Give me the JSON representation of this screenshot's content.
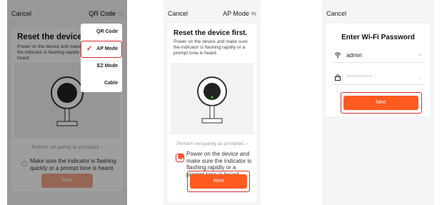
{
  "screen1": {
    "cancel": "Cancel",
    "mode_label": "QR Code",
    "mode_icon": "swap-icon",
    "title": "Reset the device firs",
    "description": "Power on the device and make sure the indicator is flashing rapidly o heard.",
    "pairing_link": "Perform net pairing as prompted.",
    "checkbox_label": "Make sure the indicator is flashing quickly or a prompt tone is heard.",
    "next_label": "Next",
    "menu": [
      {
        "label": "QR Code",
        "checked": false
      },
      {
        "label": "AP Mode",
        "checked": true
      },
      {
        "label": "EZ Mode",
        "checked": false
      },
      {
        "label": "Cable",
        "checked": false
      }
    ]
  },
  "screen2": {
    "cancel": "Cancel",
    "mode_label": "AP Mode",
    "mode_icon": "swap-icon",
    "title": "Reset the device first.",
    "description": "Power on the device and make sure the indicator is flashing rapidly or a prompt tone is heard.",
    "pairing_link": "Perform net pairing as prompted.",
    "checkbox_label": "Power on the device and make sure the indicator is flashing rapidly or a prompt tone is heard.",
    "next_label": "Next"
  },
  "screen3": {
    "cancel": "Cancel",
    "title": "Enter Wi-Fi Password",
    "ssid_value": "admin",
    "password_value": "·············",
    "next_label": "Next"
  },
  "colors": {
    "accent": "#ff5a1f",
    "highlight": "#d92d2d",
    "background": "#f5f5f7"
  }
}
